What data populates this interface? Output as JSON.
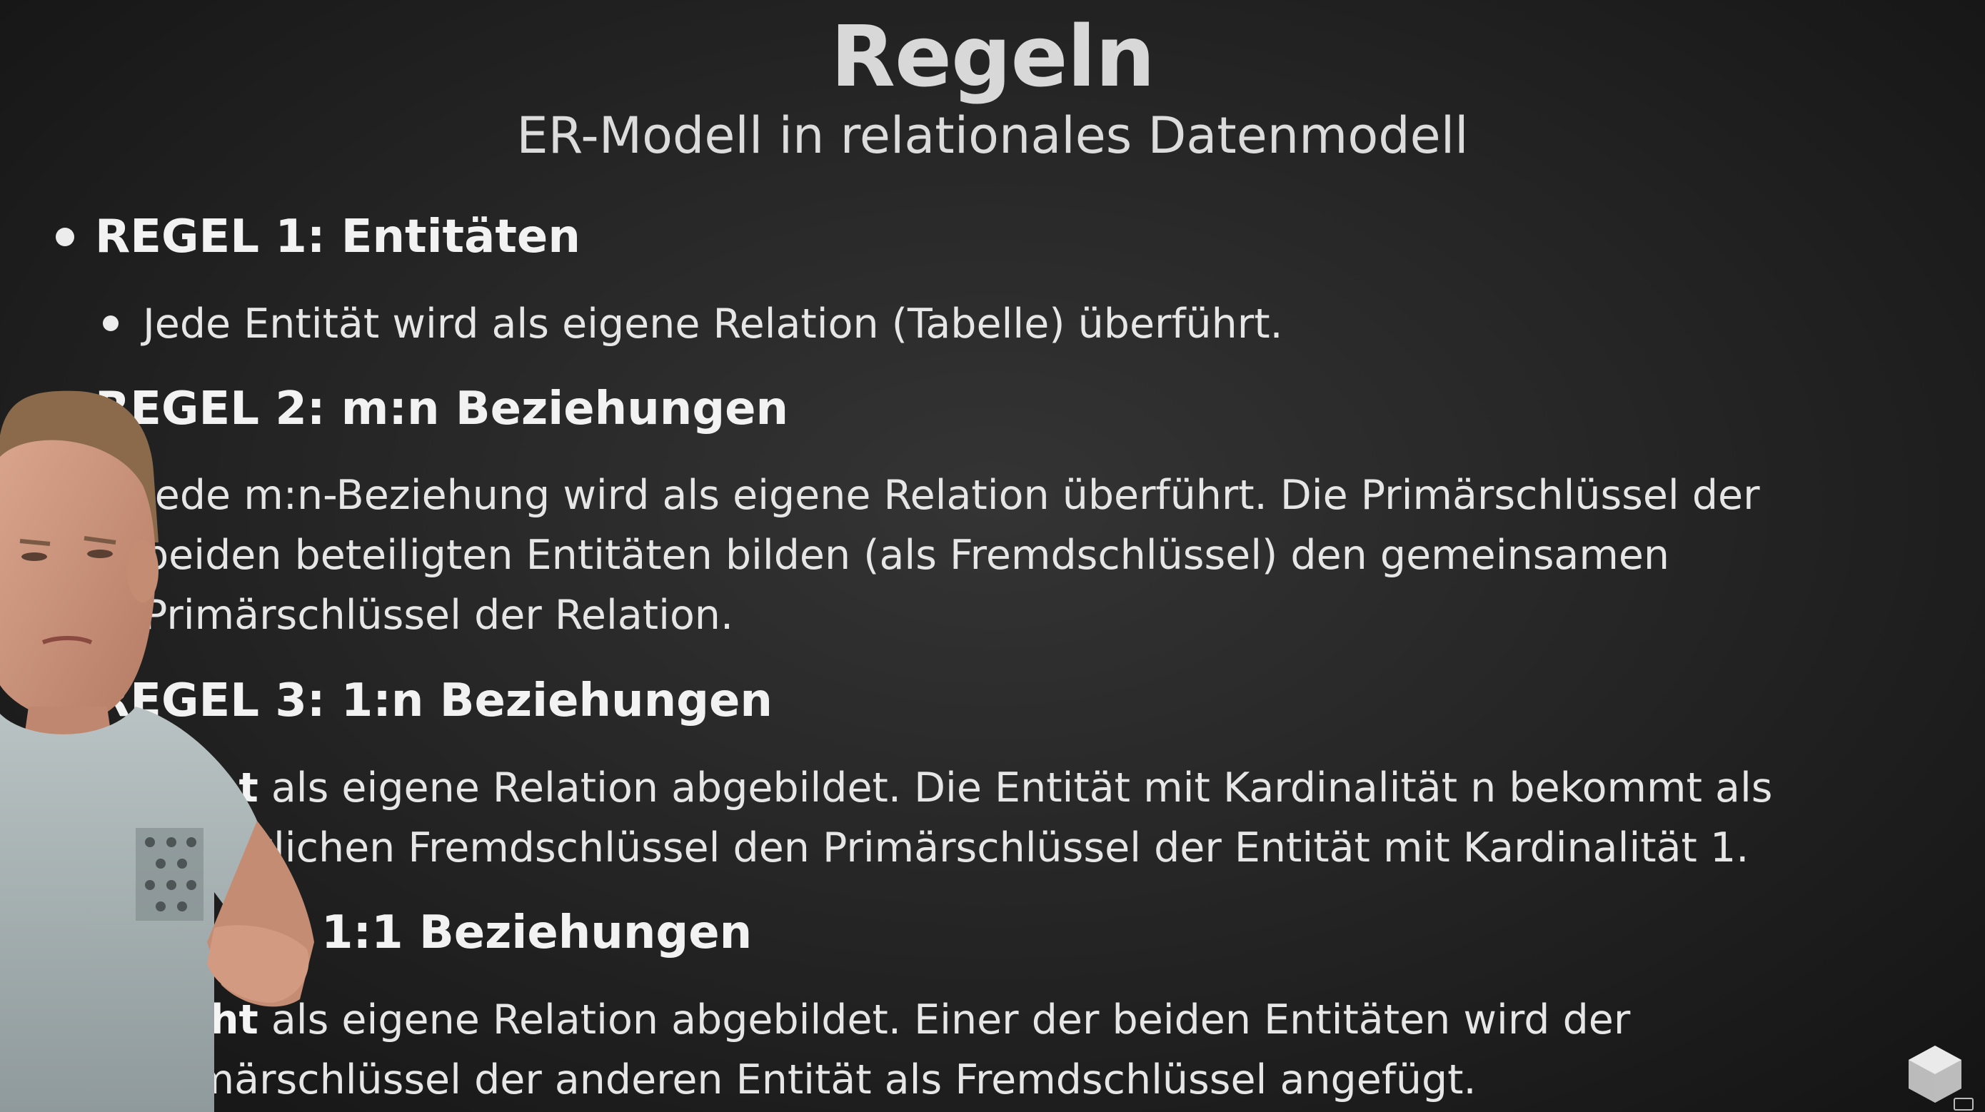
{
  "slide": {
    "title": "Regeln",
    "subtitle": "ER-Modell in relationales Datenmodell"
  },
  "rules": [
    {
      "heading": "REGEL 1: Entitäten",
      "text": "Jede Entität wird als eigene Relation (Tabelle) überführt."
    },
    {
      "heading": "REGEL 2: m:n Beziehungen",
      "text": "Jede m:n-Beziehung wird als eigene Relation überführt. Die Primärschlüssel der beiden beteiligten Entitäten bilden (als Fremdschlüssel) den gemeinsamen Primärschlüssel der Relation."
    },
    {
      "heading": "REGEL 3: 1:n Beziehungen",
      "text_bold": "nicht",
      "text_rest": " als eigene Relation abgebildet. Die Entität mit Kardinalität n bekommt als zusätzlichen Fremdschlüssel den Primärschlüssel der Entität mit Kardinalität 1."
    },
    {
      "heading": "1:1 Beziehungen",
      "text_bold": "nicht",
      "text_rest": " als eigene Relation abgebildet. Einer der beiden Entitäten wird der Primärschlüssel der anderen Entität als Fremdschlüssel angefügt."
    }
  ],
  "icons": {
    "presenter": "presenter-webcam-overlay",
    "corner": "cube-icon",
    "captions": "captions-icon"
  },
  "colors": {
    "background": "#262626",
    "text": "#ececec"
  }
}
